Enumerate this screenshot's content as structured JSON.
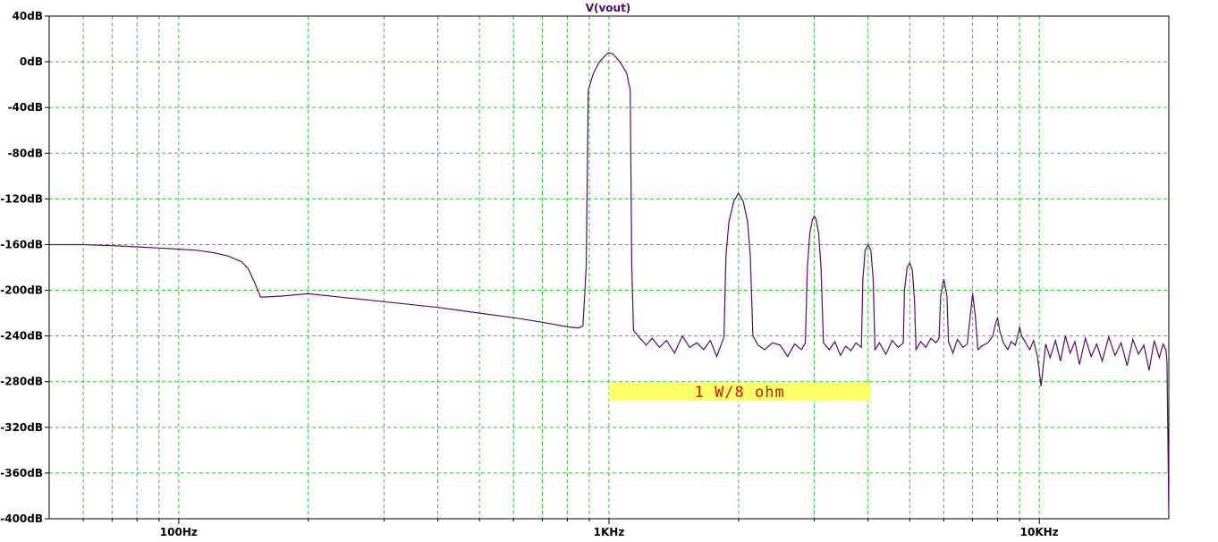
{
  "chart_data": {
    "type": "line",
    "title": "V(vout)",
    "x_scale": "log",
    "xlim_hz": [
      50,
      20000
    ],
    "ylim_db": [
      -400,
      40
    ],
    "grid": true,
    "y_ticks": [
      {
        "value": 40,
        "label": "40dB"
      },
      {
        "value": 0,
        "label": "0dB"
      },
      {
        "value": -40,
        "label": "-40dB"
      },
      {
        "value": -80,
        "label": "-80dB"
      },
      {
        "value": -120,
        "label": "-120dB"
      },
      {
        "value": -160,
        "label": "-160dB"
      },
      {
        "value": -200,
        "label": "-200dB"
      },
      {
        "value": -240,
        "label": "-240dB"
      },
      {
        "value": -280,
        "label": "-280dB"
      },
      {
        "value": -320,
        "label": "-320dB"
      },
      {
        "value": -360,
        "label": "-360dB"
      },
      {
        "value": -400,
        "label": "-400dB"
      }
    ],
    "x_ticks": [
      {
        "value": 100,
        "label": "100Hz"
      },
      {
        "value": 1000,
        "label": "1KHz"
      },
      {
        "value": 10000,
        "label": "10KHz"
      }
    ],
    "annotation": {
      "text": "1 W/8 ohm",
      "x_from_hz": 1000,
      "x_to_hz": 4050,
      "y_db": -289
    },
    "series": [
      {
        "color": "#5a0a6e",
        "points": [
          [
            50,
            -160
          ],
          [
            60,
            -160
          ],
          [
            70,
            -161
          ],
          [
            80,
            -162
          ],
          [
            90,
            -163
          ],
          [
            100,
            -164
          ],
          [
            110,
            -165
          ],
          [
            120,
            -167
          ],
          [
            130,
            -170
          ],
          [
            140,
            -175
          ],
          [
            145,
            -181
          ],
          [
            150,
            -193
          ],
          [
            155,
            -206
          ],
          [
            175,
            -205
          ],
          [
            200,
            -203
          ],
          [
            300,
            -210
          ],
          [
            400,
            -215
          ],
          [
            500,
            -220
          ],
          [
            600,
            -224
          ],
          [
            700,
            -228
          ],
          [
            800,
            -232
          ],
          [
            850,
            -233
          ],
          [
            870,
            -231
          ],
          [
            885,
            -180
          ],
          [
            895,
            -25
          ],
          [
            920,
            -10
          ],
          [
            950,
            0
          ],
          [
            990,
            7
          ],
          [
            1000,
            8
          ],
          [
            1020,
            7
          ],
          [
            1060,
            0
          ],
          [
            1100,
            -10
          ],
          [
            1120,
            -25
          ],
          [
            1130,
            -180
          ],
          [
            1140,
            -235
          ],
          [
            1180,
            -242
          ],
          [
            1220,
            -248
          ],
          [
            1260,
            -242
          ],
          [
            1310,
            -250
          ],
          [
            1360,
            -244
          ],
          [
            1420,
            -255
          ],
          [
            1480,
            -240
          ],
          [
            1540,
            -250
          ],
          [
            1600,
            -246
          ],
          [
            1660,
            -252
          ],
          [
            1720,
            -244
          ],
          [
            1780,
            -258
          ],
          [
            1850,
            -241
          ],
          [
            1870,
            -170
          ],
          [
            1900,
            -140
          ],
          [
            1950,
            -122
          ],
          [
            2000,
            -115
          ],
          [
            2050,
            -122
          ],
          [
            2100,
            -140
          ],
          [
            2130,
            -170
          ],
          [
            2160,
            -240
          ],
          [
            2220,
            -248
          ],
          [
            2300,
            -252
          ],
          [
            2400,
            -246
          ],
          [
            2500,
            -248
          ],
          [
            2600,
            -258
          ],
          [
            2700,
            -247
          ],
          [
            2800,
            -252
          ],
          [
            2860,
            -246
          ],
          [
            2890,
            -180
          ],
          [
            2930,
            -150
          ],
          [
            2970,
            -138
          ],
          [
            3000,
            -135
          ],
          [
            3030,
            -138
          ],
          [
            3070,
            -150
          ],
          [
            3110,
            -180
          ],
          [
            3150,
            -246
          ],
          [
            3250,
            -252
          ],
          [
            3350,
            -245
          ],
          [
            3450,
            -257
          ],
          [
            3550,
            -249
          ],
          [
            3650,
            -253
          ],
          [
            3750,
            -246
          ],
          [
            3860,
            -250
          ],
          [
            3890,
            -190
          ],
          [
            3940,
            -165
          ],
          [
            4000,
            -160
          ],
          [
            4060,
            -165
          ],
          [
            4110,
            -190
          ],
          [
            4150,
            -252
          ],
          [
            4250,
            -246
          ],
          [
            4400,
            -256
          ],
          [
            4550,
            -244
          ],
          [
            4700,
            -250
          ],
          [
            4830,
            -246
          ],
          [
            4860,
            -200
          ],
          [
            4930,
            -180
          ],
          [
            5000,
            -176
          ],
          [
            5070,
            -182
          ],
          [
            5130,
            -210
          ],
          [
            5170,
            -252
          ],
          [
            5300,
            -245
          ],
          [
            5450,
            -250
          ],
          [
            5600,
            -242
          ],
          [
            5750,
            -246
          ],
          [
            5850,
            -242
          ],
          [
            5900,
            -205
          ],
          [
            6000,
            -190
          ],
          [
            6100,
            -205
          ],
          [
            6150,
            -245
          ],
          [
            6300,
            -255
          ],
          [
            6450,
            -243
          ],
          [
            6650,
            -250
          ],
          [
            6800,
            -247
          ],
          [
            6900,
            -225
          ],
          [
            7000,
            -203
          ],
          [
            7100,
            -222
          ],
          [
            7200,
            -252
          ],
          [
            7400,
            -248
          ],
          [
            7600,
            -246
          ],
          [
            7800,
            -240
          ],
          [
            7900,
            -230
          ],
          [
            8000,
            -224
          ],
          [
            8100,
            -236
          ],
          [
            8250,
            -246
          ],
          [
            8450,
            -252
          ],
          [
            8600,
            -245
          ],
          [
            8800,
            -248
          ],
          [
            8950,
            -237
          ],
          [
            9000,
            -232
          ],
          [
            9100,
            -240
          ],
          [
            9300,
            -246
          ],
          [
            9500,
            -252
          ],
          [
            9700,
            -244
          ],
          [
            9900,
            -258
          ],
          [
            10100,
            -284
          ],
          [
            10350,
            -247
          ],
          [
            10600,
            -259
          ],
          [
            10900,
            -244
          ],
          [
            11200,
            -262
          ],
          [
            11500,
            -240
          ],
          [
            11800,
            -255
          ],
          [
            12100,
            -245
          ],
          [
            12400,
            -265
          ],
          [
            12800,
            -242
          ],
          [
            13200,
            -258
          ],
          [
            13600,
            -247
          ],
          [
            14000,
            -262
          ],
          [
            14500,
            -241
          ],
          [
            15000,
            -257
          ],
          [
            15500,
            -246
          ],
          [
            16000,
            -266
          ],
          [
            16500,
            -243
          ],
          [
            17000,
            -256
          ],
          [
            17500,
            -248
          ],
          [
            18000,
            -270
          ],
          [
            18500,
            -244
          ],
          [
            19000,
            -259
          ],
          [
            19400,
            -247
          ],
          [
            19700,
            -252
          ],
          [
            19800,
            -262
          ],
          [
            19900,
            -330
          ],
          [
            20000,
            -400
          ]
        ]
      }
    ]
  }
}
